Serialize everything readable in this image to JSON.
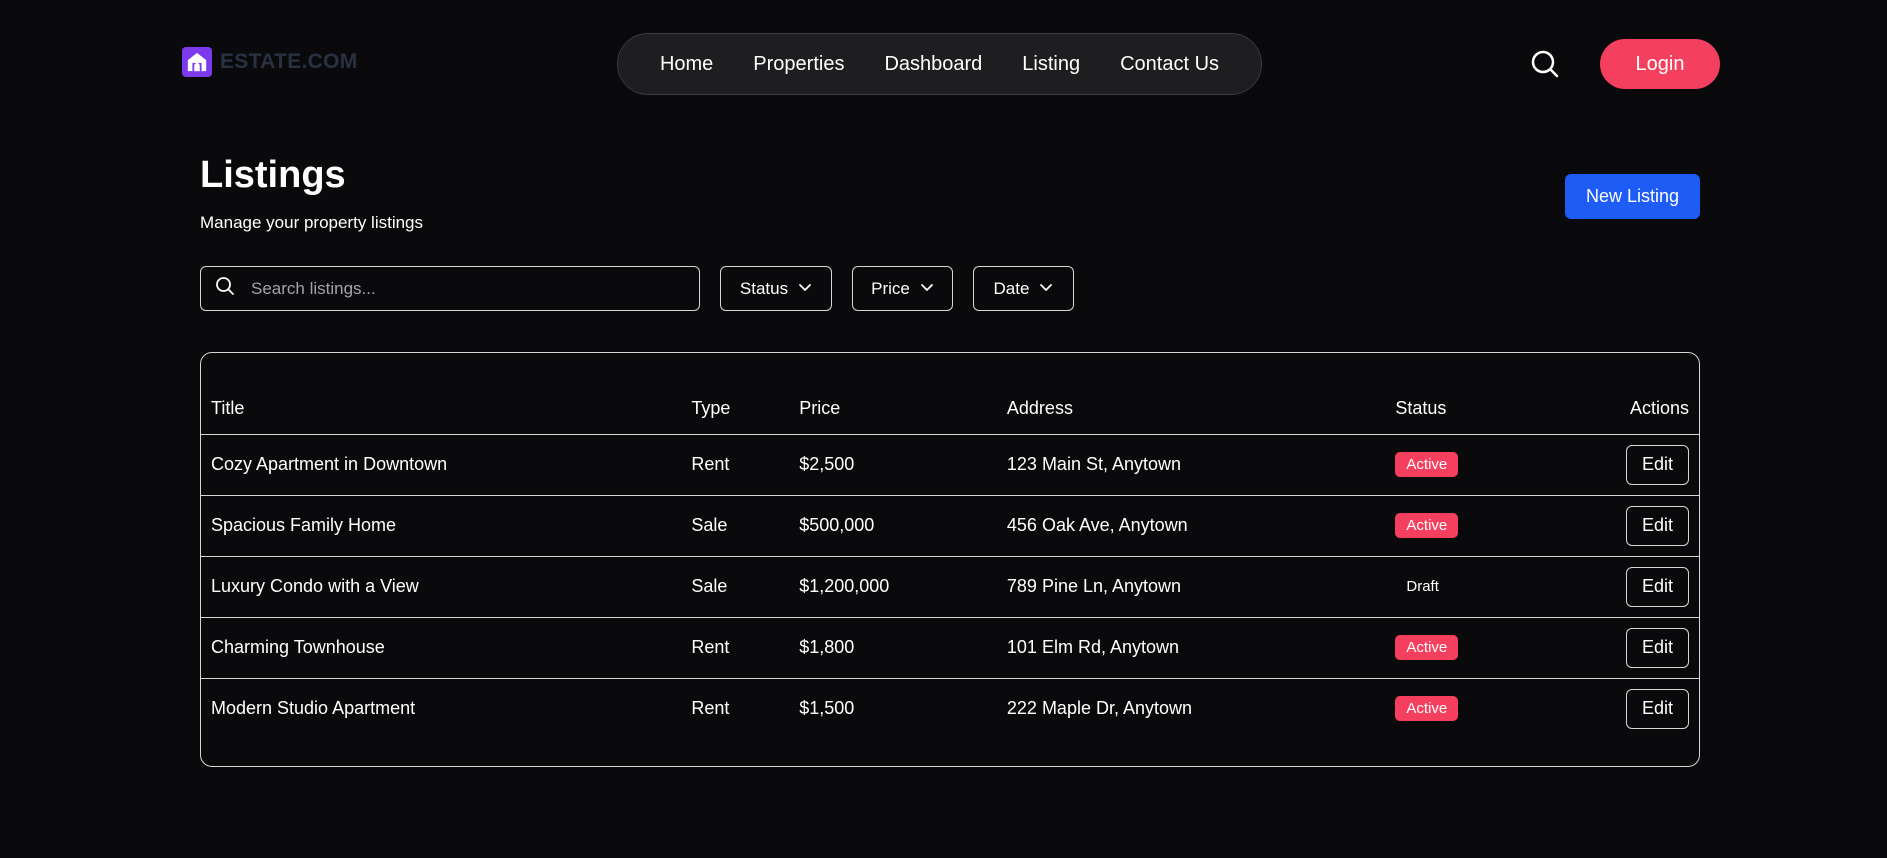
{
  "brand": {
    "logo_text": "ESTATE.COM",
    "logo_icon": "house-icon",
    "logo_color": "#7c3aed"
  },
  "nav": {
    "items": [
      "Home",
      "Properties",
      "Dashboard",
      "Listing",
      "Contact Us"
    ]
  },
  "header": {
    "search_icon": "search-icon",
    "login_label": "Login",
    "login_color": "#f43f5e"
  },
  "page": {
    "title": "Listings",
    "subtitle": "Manage your property listings",
    "new_listing_label": "New Listing",
    "new_listing_color": "#1d5cf5"
  },
  "filters": {
    "search_placeholder": "Search listings...",
    "status_label": "Status",
    "price_label": "Price",
    "date_label": "Date"
  },
  "table": {
    "columns": [
      "Title",
      "Type",
      "Price",
      "Address",
      "Status",
      "Actions"
    ],
    "edit_label": "Edit",
    "rows": [
      {
        "title": "Cozy Apartment in Downtown",
        "type": "Rent",
        "price": "$2,500",
        "address": "123 Main St, Anytown",
        "status": "Active"
      },
      {
        "title": "Spacious Family Home",
        "type": "Sale",
        "price": "$500,000",
        "address": "456 Oak Ave, Anytown",
        "status": "Active"
      },
      {
        "title": "Luxury Condo with a View",
        "type": "Sale",
        "price": "$1,200,000",
        "address": "789 Pine Ln, Anytown",
        "status": "Draft"
      },
      {
        "title": "Charming Townhouse",
        "type": "Rent",
        "price": "$1,800",
        "address": "101 Elm Rd, Anytown",
        "status": "Active"
      },
      {
        "title": "Modern Studio Apartment",
        "type": "Rent",
        "price": "$1,500",
        "address": "222 Maple Dr, Anytown",
        "status": "Active"
      }
    ]
  },
  "colors": {
    "background": "#0a0a0c",
    "active_badge": "#f43f5e"
  }
}
